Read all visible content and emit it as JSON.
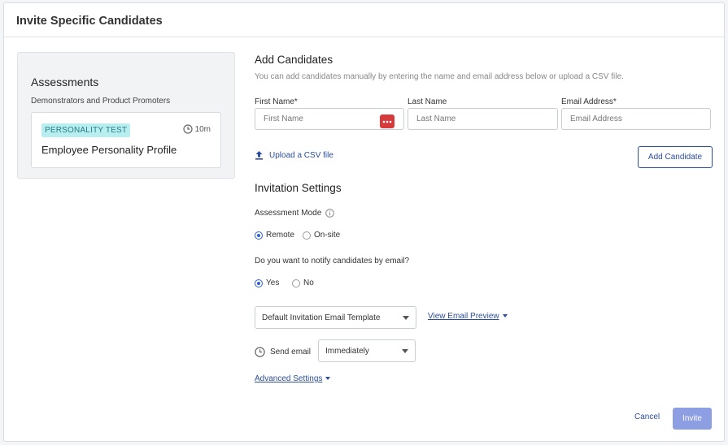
{
  "modal": {
    "title": "Invite Specific Candidates"
  },
  "assessments_panel": {
    "title": "Assessments",
    "subtitle": "Demonstrators and Product Promoters",
    "card": {
      "tag": "PERSONALITY TEST",
      "duration": "10m",
      "name": "Employee Personality Profile"
    }
  },
  "add_candidates": {
    "title": "Add Candidates",
    "hint": "You can add candidates manually by entering the name and email address below or upload a CSV file.",
    "first_name_label": "First Name*",
    "first_name_placeholder": "First Name",
    "first_name_value": "",
    "last_name_label": "Last Name",
    "last_name_placeholder": "Last Name",
    "last_name_value": "",
    "email_label": "Email Address*",
    "email_placeholder": "Email Address",
    "email_value": "",
    "upload_csv": "Upload a CSV file",
    "add_candidate_button": "Add Candidate"
  },
  "invitation_settings": {
    "title": "Invitation Settings",
    "assessment_mode_label": "Assessment Mode",
    "mode_options": [
      {
        "label": "Remote",
        "checked": true
      },
      {
        "label": "On-site",
        "checked": false
      }
    ],
    "notify_label": "Do you want to notify candidates by email?",
    "notify_options": [
      {
        "label": "Yes",
        "checked": true
      },
      {
        "label": "No",
        "checked": false
      }
    ],
    "template_select": "Default Invitation Email Template",
    "view_preview": "View Email Preview",
    "send_email_label": "Send email",
    "send_email_select": "Immediately",
    "advanced_settings": "Advanced Settings"
  },
  "footer": {
    "cancel": "Cancel",
    "invite": "Invite"
  },
  "colors": {
    "primary": "#2c4d9e",
    "tag_bg": "#b9eef0",
    "tag_text": "#227e85",
    "invite_disabled": "#8d9ee3",
    "password_icon": "#d63a3a"
  }
}
